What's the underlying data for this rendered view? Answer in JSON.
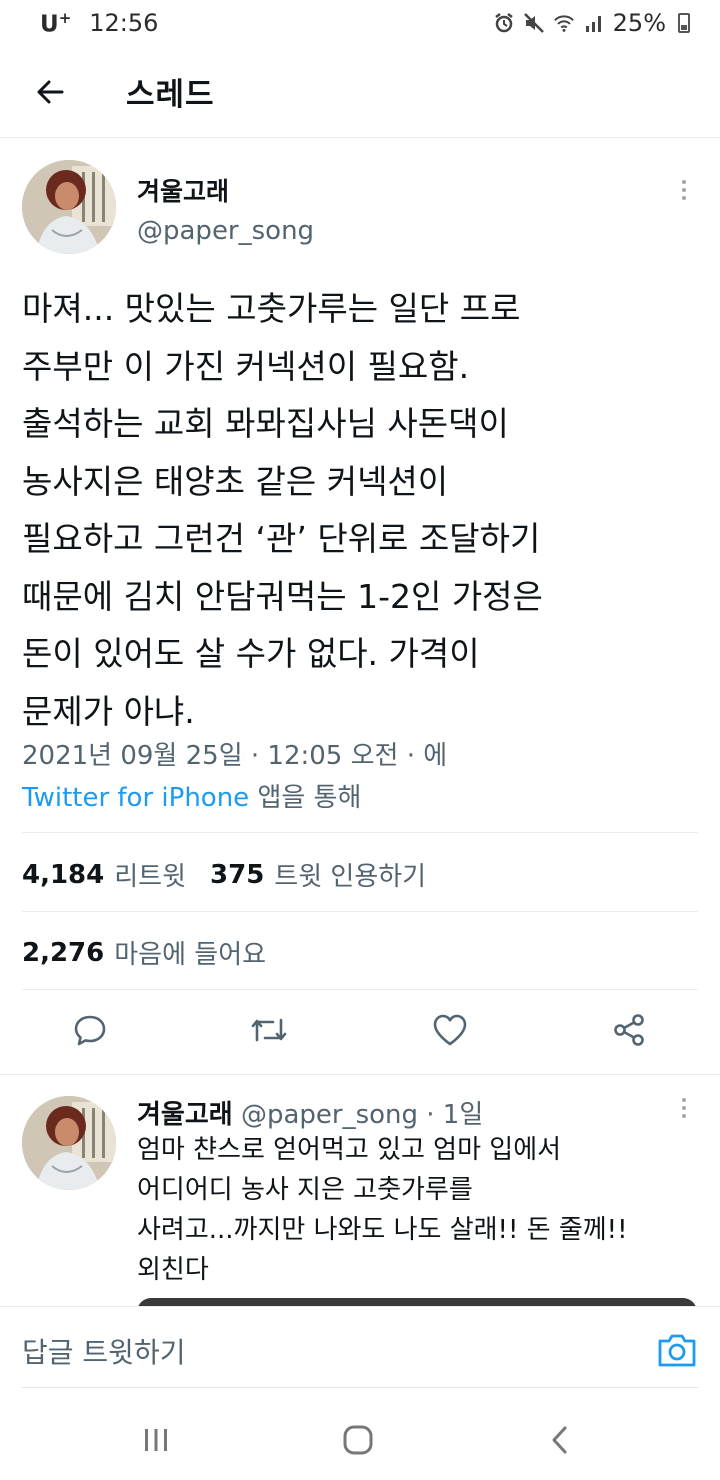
{
  "status_bar": {
    "carrier": "U",
    "carrier_sup": "+",
    "time": "12:56",
    "battery": "25%"
  },
  "header": {
    "title": "스레드"
  },
  "main_tweet": {
    "author_name": "겨울고래",
    "author_handle": "@paper_song",
    "text": "마져... 맛있는 고춧가루는 일단 프로\n주부만 이 가진 커넥션이 필요함.\n출석하는 교회 뫄뫄집사님 사돈댁이\n농사지은 태양초 같은 커넥션이\n필요하고 그런건 ‘관’ 단위로 조달하기\n때문에 김치 안담궈먹는 1-2인 가정은\n돈이 있어도 살 수가 없다. 가격이\n문제가 아냐.",
    "date": "2021년 09월 25일 · 12:05 오전 · 에",
    "source_app": "Twitter for iPhone",
    "source_suffix": " 앱을 통해",
    "retweets": "4,184",
    "retweets_label": "리트윗",
    "quotes": "375",
    "quotes_label": "트윗 인용하기",
    "likes": "2,276",
    "likes_label": "마음에 들어요"
  },
  "actions": [
    "reply-icon",
    "retweet-icon",
    "like-icon",
    "share-icon"
  ],
  "reply": {
    "author_name": "겨울고래",
    "author_handle": "@paper_song · 1일",
    "text": "엄마 챤스로 얻어먹고 있고 엄마 입에서\n어디어디 농사 지은 고춧가루를\n사려고...까지만 나와도 나도 살래!! 돈 줄께!!\n외친다"
  },
  "compose": {
    "placeholder": "답글 트윗하기"
  },
  "colors": {
    "accent": "#1d9bf0",
    "secondary_text": "#536471",
    "primary_text": "#0f1419"
  }
}
